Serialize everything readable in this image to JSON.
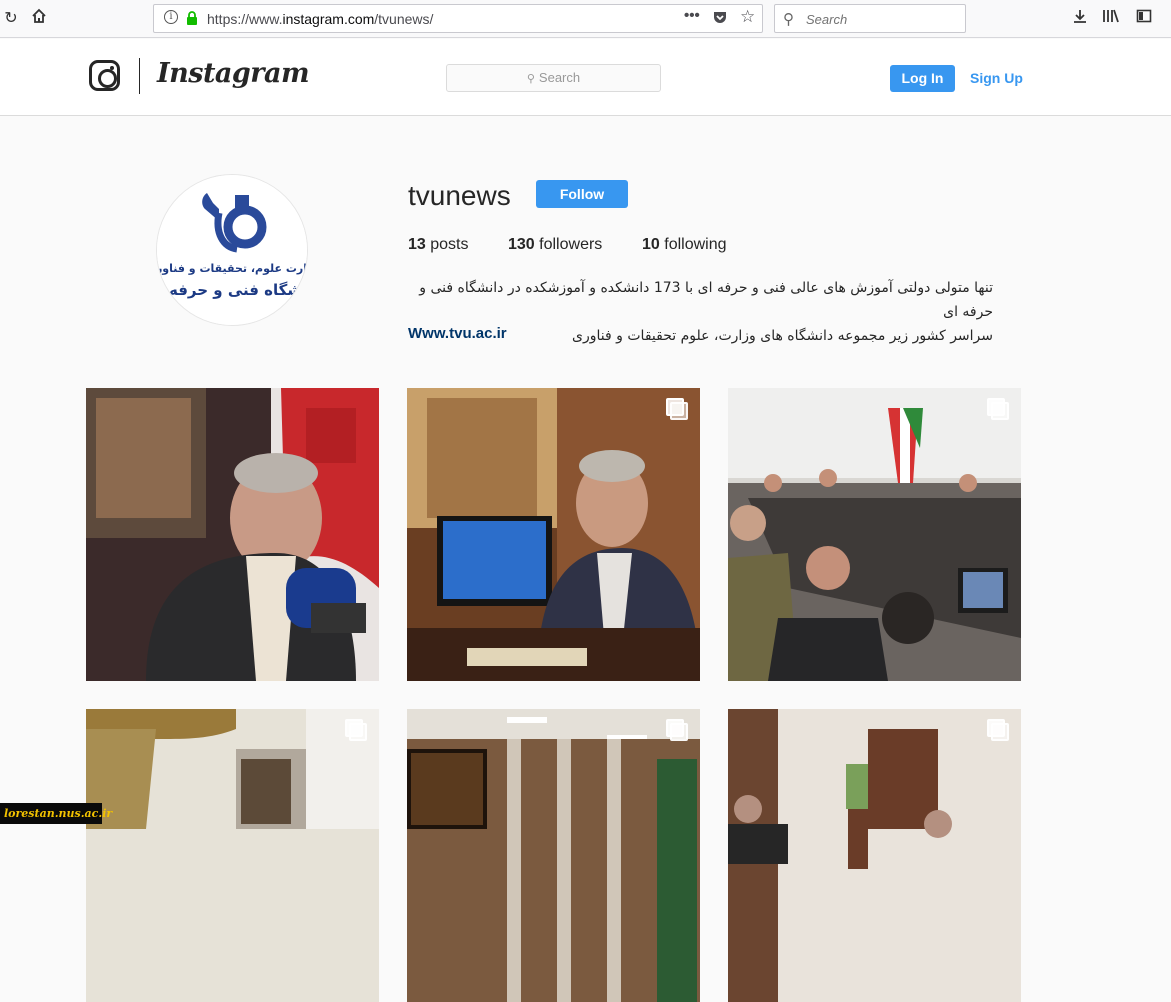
{
  "browser": {
    "url_prefix": "https://www.",
    "url_domain": "instagram.com",
    "url_path": "/tvunews/",
    "search_placeholder": "Search"
  },
  "header": {
    "wordmark": "Instagram",
    "search_placeholder": "Search",
    "login_label": "Log In",
    "signup_label": "Sign Up"
  },
  "profile": {
    "username": "tvunews",
    "follow_label": "Follow",
    "posts_count": "13",
    "posts_label": "posts",
    "followers_count": "130",
    "followers_label": "followers",
    "following_count": "10",
    "following_label": "following",
    "bio_line1": "تنها متولی دولتی آموزش های عالی فنی و حرفه ای با 173 دانشکده و آموزشکده در دانشگاه فنی و حرفه ای",
    "bio_line2": "سراسر کشور زیر مجموعه دانشگاه های وزارت، علوم تحقیقات و فناوری",
    "website": "Www.tvu.ac.ir",
    "avatar_text_line1": "وزارت علوم، تحقیقات و فناوری",
    "avatar_text_line2": "دانشگاه فنی و حرفه ای"
  },
  "posts": [
    {
      "multi": false
    },
    {
      "multi": true
    },
    {
      "multi": true
    },
    {
      "multi": true
    },
    {
      "multi": true
    },
    {
      "multi": true
    }
  ],
  "watermark": "lorestan.nus.ac.ir",
  "colors": {
    "accent": "#3897f0",
    "link": "#003569"
  }
}
